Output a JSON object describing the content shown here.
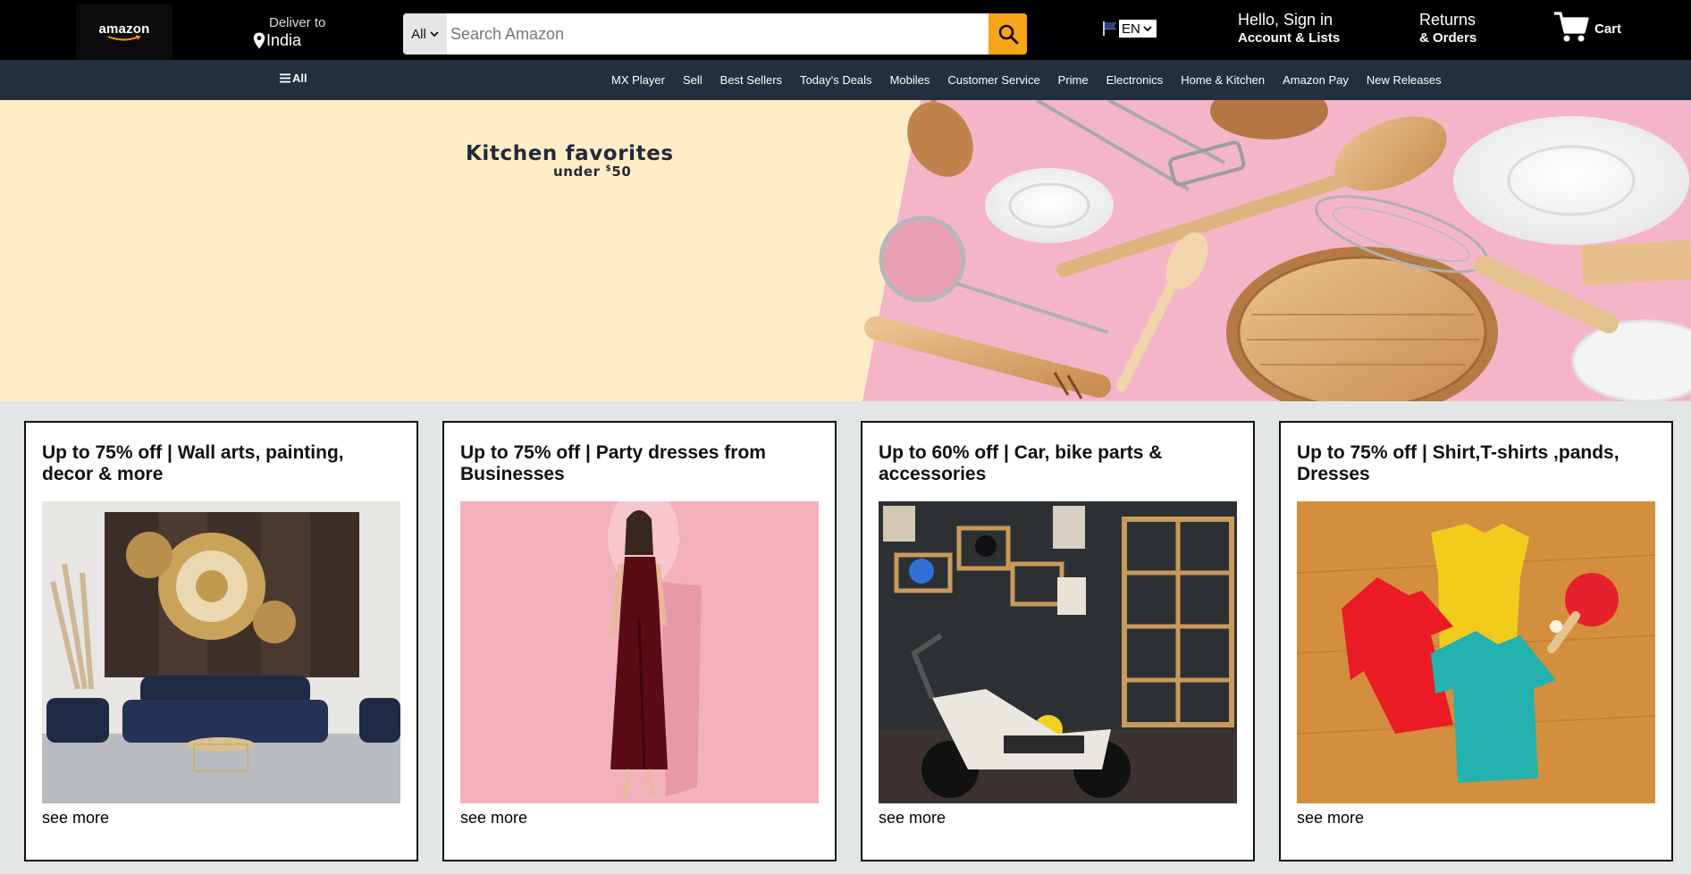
{
  "header": {
    "logo_text": "amazon",
    "deliver_label": "Deliver to",
    "deliver_location": "India",
    "search": {
      "category": "All",
      "placeholder": "Search Amazon",
      "value": ""
    },
    "language": "EN",
    "account_greeting": "Hello, Sign in",
    "account_lists": "Account & Lists",
    "returns": "Returns",
    "orders": "& Orders",
    "cart_label": "Cart"
  },
  "nav": {
    "all_label": "All",
    "links": [
      "MX Player",
      "Sell",
      "Best Sellers",
      "Today's Deals",
      "Mobiles",
      "Customer Service",
      "Prime",
      "Electronics",
      "Home & Kitchen",
      "Amazon Pay",
      "New Releases"
    ]
  },
  "hero": {
    "title": "Kitchen favorites",
    "subtitle_prefix": "under ",
    "subtitle_currency": "$",
    "subtitle_amount": "50"
  },
  "cards": [
    {
      "title": "Up to 75% off | Wall arts, painting, decor & more",
      "link": "see more"
    },
    {
      "title": "Up to 75% off | Party dresses from Businesses",
      "link": "see more"
    },
    {
      "title": "Up to 60% off | Car, bike parts & accessories",
      "link": "see more"
    },
    {
      "title": "Up to 75% off | Shirt,T-shirts ,pands, Dresses",
      "link": "see more"
    }
  ],
  "colors": {
    "header_bg": "#000000",
    "nav_bg": "#232f3e",
    "search_button": "#f9a51a",
    "hero_left_bg": "#ffedc8",
    "hero_right_bg": "#f5b5c8",
    "page_bg": "#e3e6e6"
  },
  "icons": {
    "location": "map-pin-icon",
    "search": "magnifier-icon",
    "language": "flag-icon",
    "cart": "shopping-cart-icon",
    "menu": "hamburger-icon"
  }
}
